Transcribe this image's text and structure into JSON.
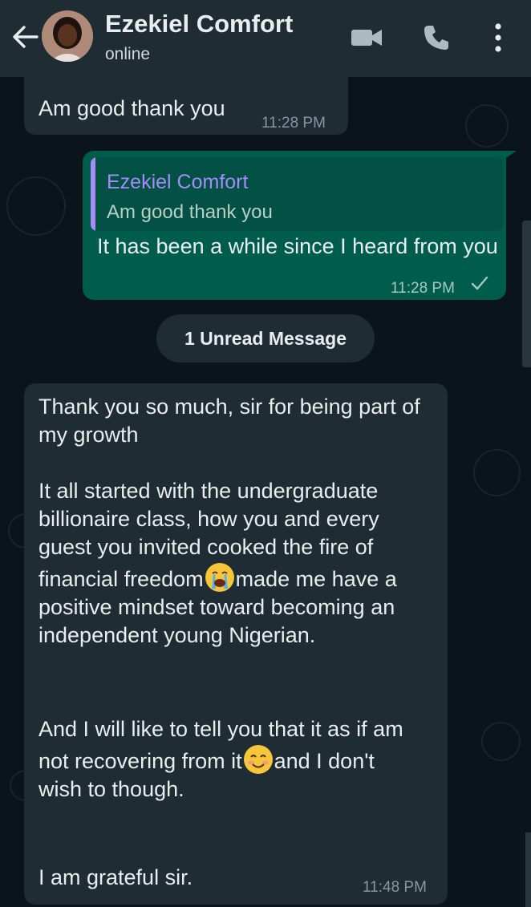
{
  "header": {
    "contact_name": "Ezekiel Comfort",
    "status": "online"
  },
  "messages": [
    {
      "direction": "incoming",
      "text": "Am good thank you",
      "time": "11:28 PM"
    },
    {
      "direction": "outgoing",
      "quote_author": "Ezekiel Comfort",
      "quote_text": "Am good thank you",
      "text": "It has been a while since I heard from you",
      "time": "11:28 PM",
      "status_icon": "check-icon"
    }
  ],
  "unread_divider": "1 Unread Message",
  "long_message": {
    "direction": "incoming",
    "paragraphs": [
      "Thank you so much, sir for being part of my growth",
      "It all started with the undergraduate billionaire class, how you and every guest you invited cooked the fire of",
      "financial freedom",
      "made me have a positive mindset toward becoming an independent young Nigerian.",
      "And I will like to tell you that it as if am not recovering from it",
      "and I don't wish to though.",
      "I am grateful sir."
    ],
    "emojis": [
      "crying-face-emoji",
      "smiling-face-emoji"
    ],
    "time": "11:48 PM"
  },
  "colors": {
    "background": "#0b141a",
    "header": "#1f2c34",
    "incoming_bubble": "#202c33",
    "outgoing_bubble": "#005c4b",
    "quote_accent": "#a78bfa"
  }
}
